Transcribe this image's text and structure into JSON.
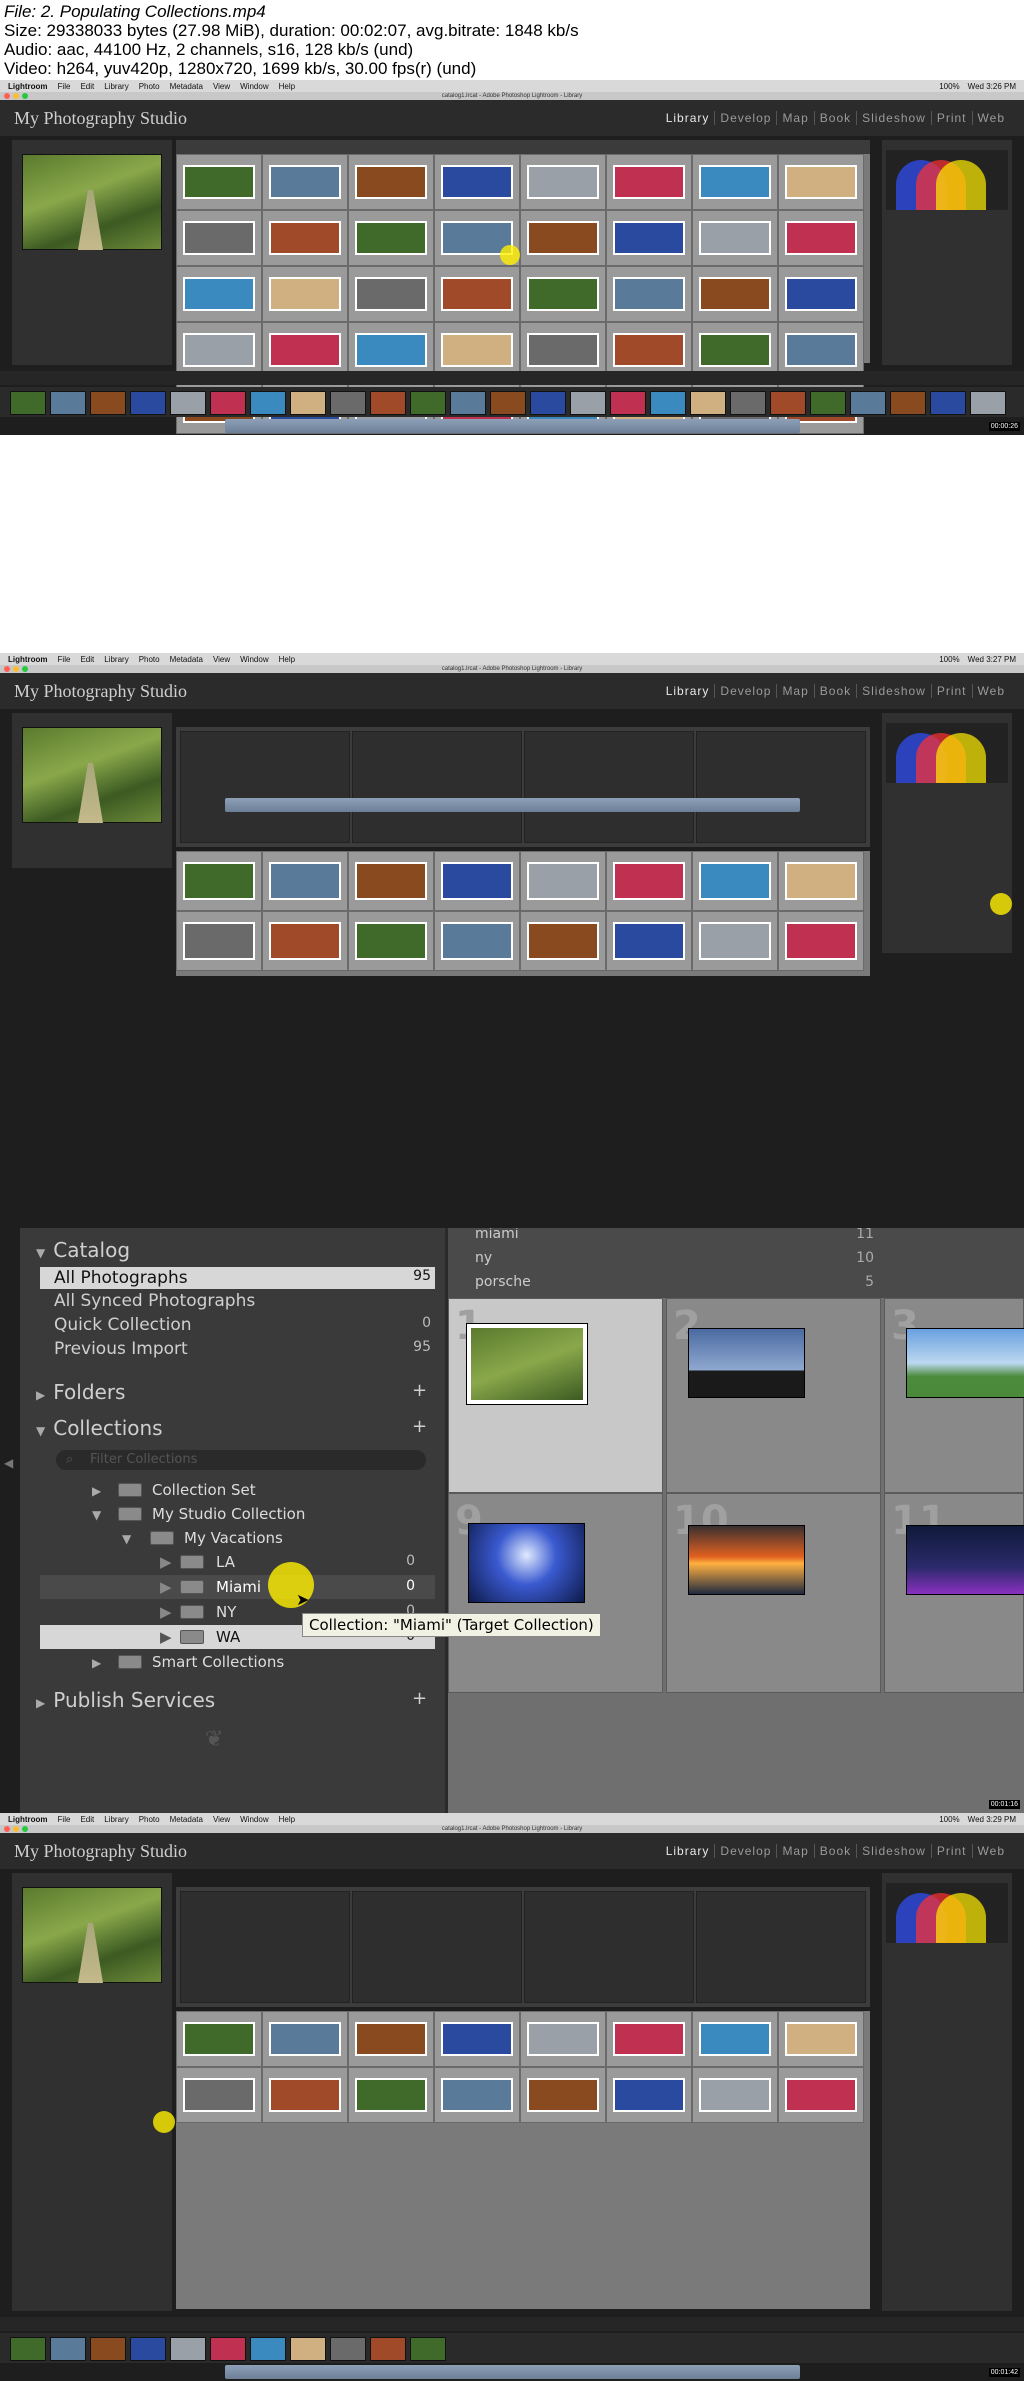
{
  "file_info": {
    "line1": "File: 2. Populating Collections.mp4",
    "line2": "Size: 29338033 bytes (27.98 MiB), duration: 00:02:07, avg.bitrate: 1848 kb/s",
    "line3": "Audio: aac, 44100 Hz, 2 channels, s16, 128 kb/s (und)",
    "line4": "Video: h264, yuv420p, 1280x720, 1699 kb/s, 30.00 fps(r) (und)"
  },
  "app": {
    "studio_name": "My Photography Studio",
    "window_title": "catalog1.lrcat - Adobe Photoshop Lightroom - Library",
    "menu": [
      "Lightroom",
      "File",
      "Edit",
      "Library",
      "Photo",
      "Metadata",
      "View",
      "Window",
      "Help"
    ],
    "modules": [
      "Library",
      "Develop",
      "Map",
      "Book",
      "Slideshow",
      "Print",
      "Web"
    ],
    "zoom": "100%"
  },
  "frames": [
    {
      "clock": "Wed 3:26 PM",
      "timestamp": "00:00:26"
    },
    {
      "clock": "Wed 3:27 PM",
      "timestamp": "00:00:52"
    },
    {
      "clock": "Wed 3:28 PM",
      "timestamp": "00:01:16"
    },
    {
      "clock": "Wed 3:29 PM",
      "timestamp": "00:01:42"
    }
  ],
  "zoom_view": {
    "catalog": {
      "header": "Catalog",
      "items": [
        {
          "label": "All Photographs",
          "count": "95"
        },
        {
          "label": "All Synced Photographs",
          "count": ""
        },
        {
          "label": "Quick Collection",
          "count": "0"
        },
        {
          "label": "Previous Import",
          "count": "95"
        }
      ]
    },
    "folders_header": "Folders",
    "collections": {
      "header": "Collections",
      "filter_placeholder": "Filter Collections",
      "items": [
        {
          "label": "Collection Set",
          "count": ""
        },
        {
          "label": "My Studio Collection",
          "count": ""
        },
        {
          "label": "My Vacations",
          "count": ""
        },
        {
          "label": "LA",
          "count": "0"
        },
        {
          "label": "Miami",
          "count": "0"
        },
        {
          "label": "NY",
          "count": "0"
        },
        {
          "label": "WA",
          "count": "0"
        },
        {
          "label": "Smart Collections",
          "count": ""
        }
      ]
    },
    "publish_header": "Publish Services",
    "tooltip": "Collection: \"Miami\" (Target Collection)",
    "keywords": [
      {
        "label": "miami",
        "count": "11"
      },
      {
        "label": "ny",
        "count": "10"
      },
      {
        "label": "porsche",
        "count": "5"
      }
    ],
    "cell_numbers": [
      "1",
      "2",
      "3",
      "9",
      "10",
      "11"
    ]
  }
}
